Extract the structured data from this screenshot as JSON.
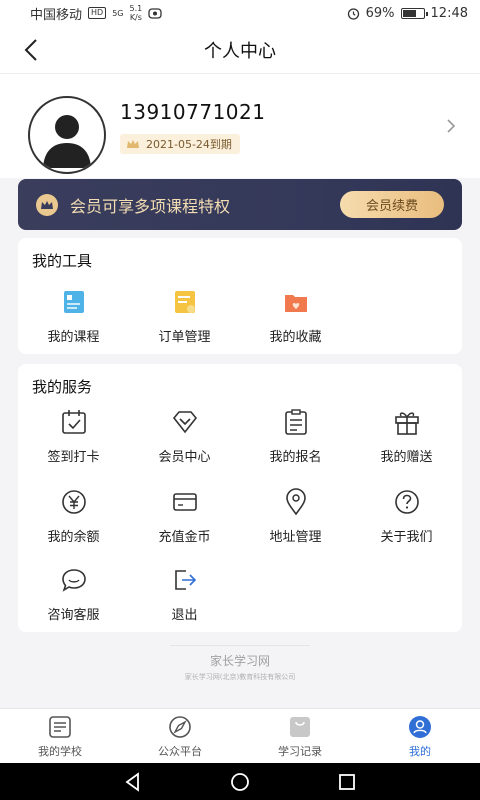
{
  "status_bar": {
    "carrier": "中国移动",
    "hd": "HD",
    "signal": "5G",
    "speed_top": "5.1",
    "speed_bottom": "K/s",
    "battery_text": "69%",
    "battery_level": 0.69,
    "time": "12:48"
  },
  "header": {
    "title": "个人中心"
  },
  "profile": {
    "phone": "13910771021",
    "expiry": "2021-05-24到期"
  },
  "vip_banner": {
    "text": "会员可享多项课程特权",
    "button": "会员续费"
  },
  "tools": {
    "title": "我的工具",
    "items": [
      {
        "label": "我的课程",
        "icon": "course-icon"
      },
      {
        "label": "订单管理",
        "icon": "order-icon"
      },
      {
        "label": "我的收藏",
        "icon": "favorite-folder-icon"
      }
    ]
  },
  "services": {
    "title": "我的服务",
    "items": [
      {
        "label": "签到打卡",
        "icon": "calendar-check-icon"
      },
      {
        "label": "会员中心",
        "icon": "diamond-icon"
      },
      {
        "label": "我的报名",
        "icon": "clipboard-icon"
      },
      {
        "label": "我的赠送",
        "icon": "gift-icon"
      },
      {
        "label": "我的余额",
        "icon": "yen-icon"
      },
      {
        "label": "充值金币",
        "icon": "card-icon"
      },
      {
        "label": "地址管理",
        "icon": "location-icon"
      },
      {
        "label": "关于我们",
        "icon": "question-icon"
      },
      {
        "label": "咨询客服",
        "icon": "chat-icon"
      },
      {
        "label": "退出",
        "icon": "logout-icon"
      }
    ]
  },
  "footer": {
    "logo_title": "家长学习网",
    "logo_sub": "家长学习网(北京)教育科技有限公司"
  },
  "tabs": [
    {
      "label": "我的学校",
      "icon": "school-icon",
      "active": false
    },
    {
      "label": "公众平台",
      "icon": "compass-icon",
      "active": false
    },
    {
      "label": "学习记录",
      "icon": "bag-icon",
      "active": false
    },
    {
      "label": "我的",
      "icon": "user-icon",
      "active": true
    }
  ],
  "colors": {
    "accent": "#2f6fd6",
    "vip_banner": "#363a5a",
    "vip_gold": "#e9bd7e"
  }
}
